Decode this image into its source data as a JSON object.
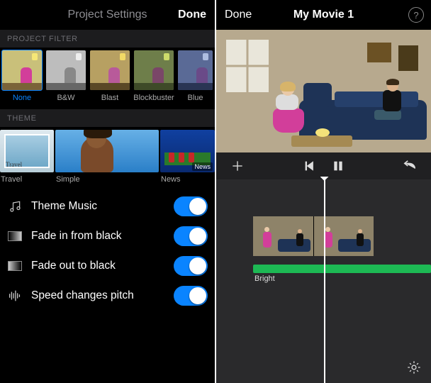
{
  "settings": {
    "header_title": "Project Settings",
    "done_label": "Done",
    "sections": {
      "filter": "PROJECT FILTER",
      "theme": "THEME"
    },
    "filters": [
      {
        "id": "none",
        "label": "None",
        "selected": true
      },
      {
        "id": "bw",
        "label": "B&W",
        "selected": false
      },
      {
        "id": "blast",
        "label": "Blast",
        "selected": false
      },
      {
        "id": "blockbuster",
        "label": "Blockbuster",
        "selected": false
      },
      {
        "id": "blue",
        "label": "Blue",
        "selected": false
      }
    ],
    "themes": [
      {
        "id": "travel",
        "label": "Travel"
      },
      {
        "id": "simple",
        "label": "Simple"
      },
      {
        "id": "news",
        "label": "News",
        "badge": "News"
      }
    ],
    "options": {
      "theme_music": {
        "label": "Theme Music",
        "on": true
      },
      "fade_in": {
        "label": "Fade in from black",
        "on": true
      },
      "fade_out": {
        "label": "Fade out to black",
        "on": true
      },
      "speed_pitch": {
        "label": "Speed changes pitch",
        "on": true
      }
    }
  },
  "movie": {
    "done_label": "Done",
    "title": "My Movie 1",
    "audio_clip_label": "Bright",
    "icons": {
      "add": "add-icon",
      "skip_back": "skip-back-icon",
      "pause": "pause-icon",
      "undo": "undo-icon",
      "help": "help-icon",
      "gear": "gear-icon"
    }
  }
}
